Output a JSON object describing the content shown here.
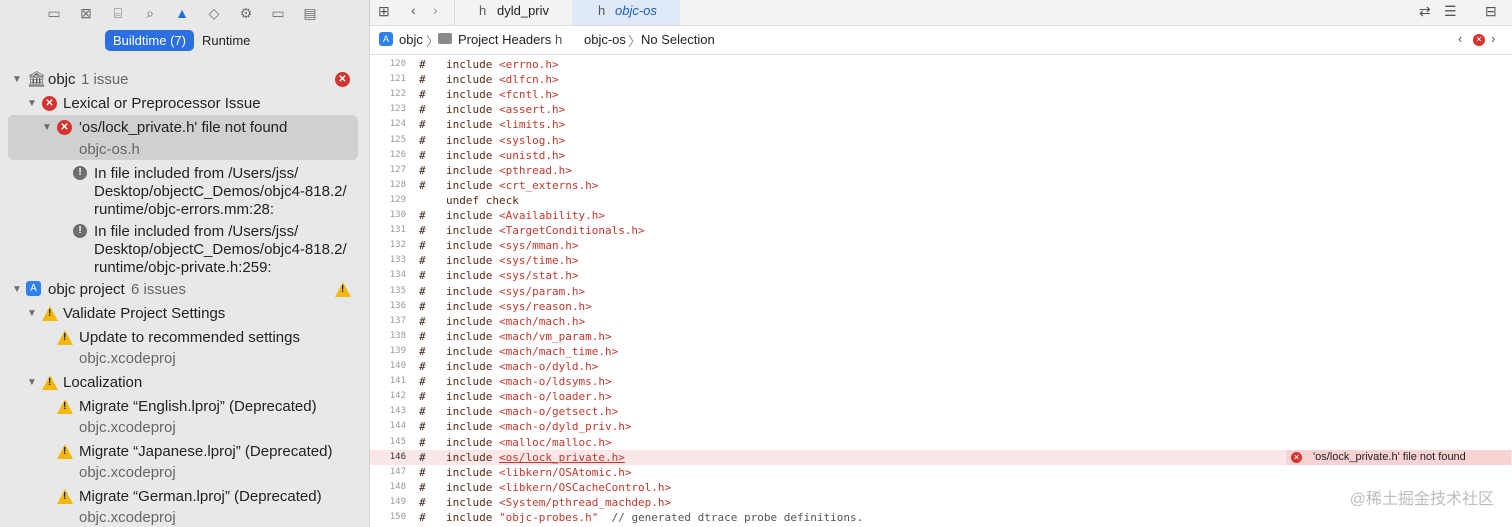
{
  "navigator": {
    "segments": [
      "Buildtime (7)",
      "Runtime"
    ],
    "tree": [
      {
        "label": "objc",
        "sub": "1 issue",
        "level": 0,
        "icon": "library"
      },
      {
        "label": "Lexical or Preprocessor Issue",
        "level": 1,
        "icon": "error"
      },
      {
        "label": "'os/lock_private.h' file not found",
        "file": "objc-os.h",
        "level": 2,
        "icon": "error",
        "selected": true
      },
      {
        "lines": [
          "In file included from /Users/jss/",
          "Desktop/objectC_Demos/objc4-818.2/",
          "runtime/objc-errors.mm:28:"
        ],
        "icon": "note"
      },
      {
        "lines": [
          "In file included from /Users/jss/",
          "Desktop/objectC_Demos/objc4-818.2/",
          "runtime/objc-private.h:259:"
        ],
        "icon": "note"
      },
      {
        "label": "objc project",
        "sub": "6 issues",
        "level": 0,
        "icon": "project"
      },
      {
        "label": "Validate Project Settings",
        "level": 1,
        "icon": "warning"
      },
      {
        "label": "Update to recommended settings",
        "file": "objc.xcodeproj",
        "level": 2,
        "icon": "warning"
      },
      {
        "label": "Localization",
        "level": 1,
        "icon": "warning"
      },
      {
        "label": "Migrate “English.lproj” (Deprecated)",
        "file": "objc.xcodeproj",
        "level": 2,
        "icon": "warning"
      },
      {
        "label": "Migrate “Japanese.lproj” (Deprecated)",
        "file": "objc.xcodeproj",
        "level": 2,
        "icon": "warning"
      },
      {
        "label": "Migrate “German.lproj” (Deprecated)",
        "file": "objc.xcodeproj",
        "level": 2,
        "icon": "warning"
      }
    ]
  },
  "editor": {
    "tabs": [
      {
        "label": "dyld_priv",
        "active": false
      },
      {
        "label": "objc-os",
        "active": true
      }
    ],
    "jumpbar": [
      "objc",
      "Project Headers",
      "objc-os",
      "No Selection"
    ],
    "lines": [
      {
        "n": "120",
        "hash": "#",
        "kw": "include",
        "hdr": "<errno.h>"
      },
      {
        "n": "121",
        "hash": "#",
        "kw": "include",
        "hdr": "<dlfcn.h>"
      },
      {
        "n": "122",
        "hash": "#",
        "kw": "include",
        "hdr": "<fcntl.h>"
      },
      {
        "n": "123",
        "hash": "#",
        "kw": "include",
        "hdr": "<assert.h>"
      },
      {
        "n": "124",
        "hash": "#",
        "kw": "include",
        "hdr": "<limits.h>"
      },
      {
        "n": "125",
        "hash": "#",
        "kw": "include",
        "hdr": "<syslog.h>"
      },
      {
        "n": "126",
        "hash": "#",
        "kw": "include",
        "hdr": "<unistd.h>"
      },
      {
        "n": "127",
        "hash": "#",
        "kw": "include",
        "hdr": "<pthread.h>"
      },
      {
        "n": "128",
        "hash": "#",
        "kw": "include",
        "hdr": "<crt_externs.h>"
      },
      {
        "n": "129",
        "hash": "",
        "kw": "undef check",
        "hdr": ""
      },
      {
        "n": "130",
        "hash": "#",
        "kw": "include",
        "hdr": "<Availability.h>"
      },
      {
        "n": "131",
        "hash": "#",
        "kw": "include",
        "hdr": "<TargetConditionals.h>"
      },
      {
        "n": "132",
        "hash": "#",
        "kw": "include",
        "hdr": "<sys/mman.h>"
      },
      {
        "n": "133",
        "hash": "#",
        "kw": "include",
        "hdr": "<sys/time.h>"
      },
      {
        "n": "134",
        "hash": "#",
        "kw": "include",
        "hdr": "<sys/stat.h>"
      },
      {
        "n": "135",
        "hash": "#",
        "kw": "include",
        "hdr": "<sys/param.h>"
      },
      {
        "n": "136",
        "hash": "#",
        "kw": "include",
        "hdr": "<sys/reason.h>"
      },
      {
        "n": "137",
        "hash": "#",
        "kw": "include",
        "hdr": "<mach/mach.h>"
      },
      {
        "n": "138",
        "hash": "#",
        "kw": "include",
        "hdr": "<mach/vm_param.h>"
      },
      {
        "n": "139",
        "hash": "#",
        "kw": "include",
        "hdr": "<mach/mach_time.h>"
      },
      {
        "n": "140",
        "hash": "#",
        "kw": "include",
        "hdr": "<mach-o/dyld.h>"
      },
      {
        "n": "141",
        "hash": "#",
        "kw": "include",
        "hdr": "<mach-o/ldsyms.h>"
      },
      {
        "n": "142",
        "hash": "#",
        "kw": "include",
        "hdr": "<mach-o/loader.h>"
      },
      {
        "n": "143",
        "hash": "#",
        "kw": "include",
        "hdr": "<mach-o/getsect.h>"
      },
      {
        "n": "144",
        "hash": "#",
        "kw": "include",
        "hdr": "<mach-o/dyld_priv.h>"
      },
      {
        "n": "145",
        "hash": "#",
        "kw": "include",
        "hdr": "<malloc/malloc.h>"
      },
      {
        "n": "146",
        "hash": "#",
        "kw": "include",
        "hdr": "<os/lock_private.h>",
        "error": true
      },
      {
        "n": "147",
        "hash": "#",
        "kw": "include",
        "hdr": "<libkern/OSAtomic.h>"
      },
      {
        "n": "148",
        "hash": "#",
        "kw": "include",
        "hdr": "<libkern/OSCacheControl.h>"
      },
      {
        "n": "149",
        "hash": "#",
        "kw": "include",
        "hdr": "<System/pthread_machdep.h>"
      },
      {
        "n": "150",
        "hash": "#",
        "kw": "include",
        "hdr": "\"objc-probes.h\"",
        "comment": "  // generated dtrace probe definitions."
      }
    ],
    "error_message": "'os/lock_private.h' file not found"
  },
  "watermark": "@稀土掘金技术社区"
}
